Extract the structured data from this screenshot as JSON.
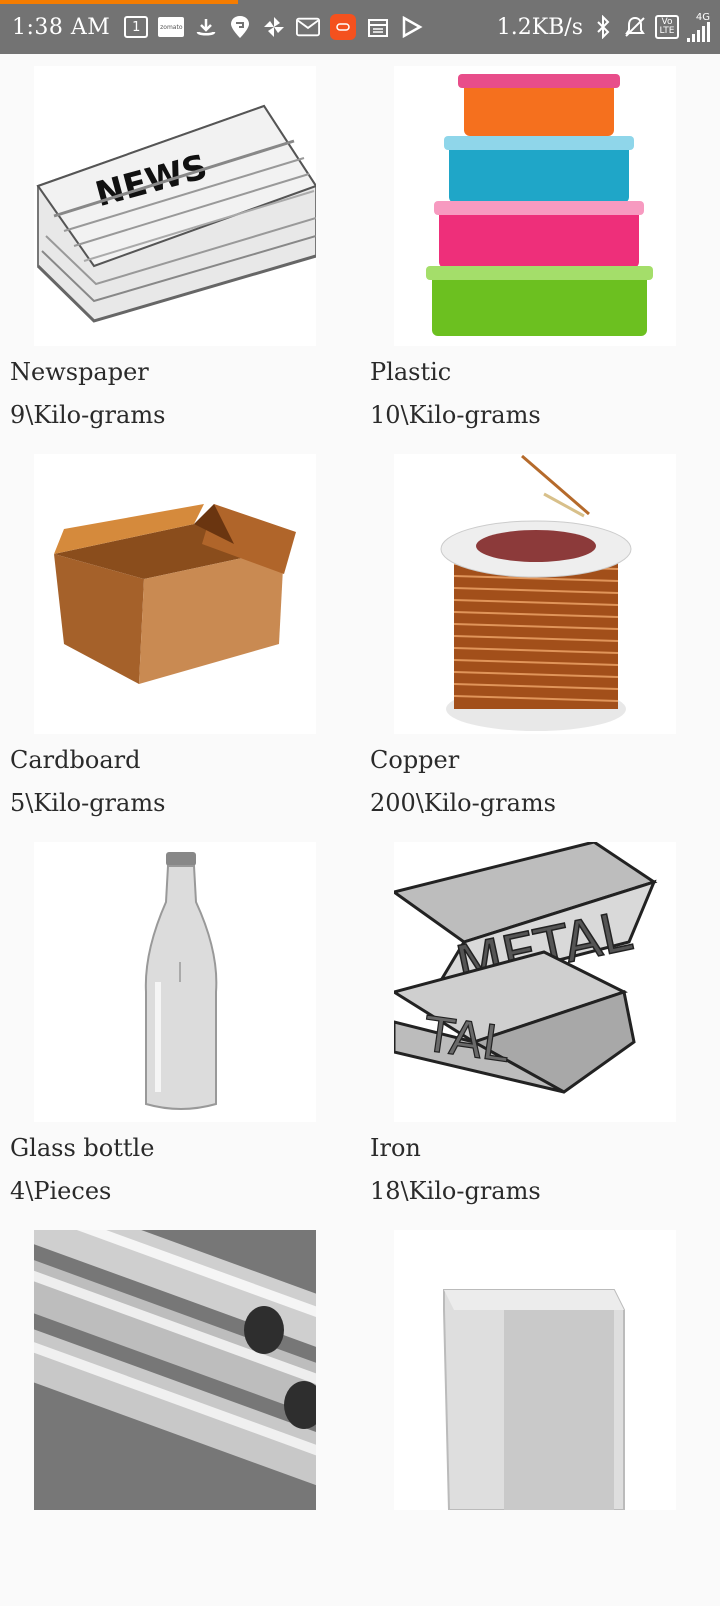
{
  "status_bar": {
    "time": "1:38 AM",
    "icons": [
      "calendar-1-icon",
      "zomato-icon",
      "download-icon",
      "swiggy-icon",
      "pinwheel-icon",
      "gmail-icon",
      "app-icon",
      "calendar-icon",
      "play-store-icon"
    ],
    "calendar_day": "1",
    "zomato_label": "zomato",
    "speed": "1.2KB/s",
    "network": "4G",
    "volte": "Vo LTE"
  },
  "items": [
    {
      "name": "Newspaper",
      "qty": "9\\Kilo-grams",
      "image": "newspaper-image"
    },
    {
      "name": "Plastic",
      "qty": "10\\Kilo-grams",
      "image": "plastic-containers-image"
    },
    {
      "name": "Cardboard",
      "qty": "5\\Kilo-grams",
      "image": "cardboard-box-image"
    },
    {
      "name": "Copper",
      "qty": "200\\Kilo-grams",
      "image": "copper-wire-image"
    },
    {
      "name": "Glass bottle",
      "qty": "4\\Pieces",
      "image": "glass-bottle-image"
    },
    {
      "name": "Iron",
      "qty": "18\\Kilo-grams",
      "image": "metal-ingots-image"
    },
    {
      "name": "",
      "qty": "",
      "image": "steel-pipes-image"
    },
    {
      "name": "",
      "qty": "",
      "image": "tin-can-image"
    }
  ],
  "images": {
    "newspaper_text": "NEWS",
    "metal_text": "METAL",
    "metal_text_2": "TAL"
  },
  "colors": {
    "status_bar": "#737373",
    "progress": "#f57c00",
    "background": "#fafafa"
  }
}
